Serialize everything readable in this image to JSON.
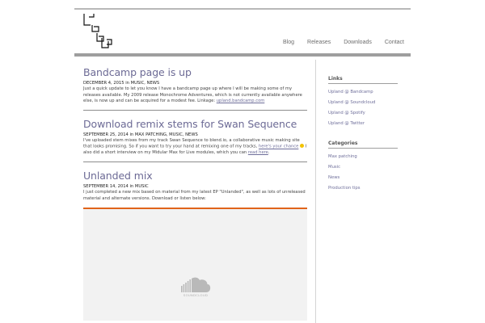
{
  "nav": {
    "items": [
      {
        "label": "Blog"
      },
      {
        "label": "Releases"
      },
      {
        "label": "Downloads"
      },
      {
        "label": "Contact"
      }
    ]
  },
  "posts": [
    {
      "title": "Bandcamp page is up",
      "date": "DECEMBER 4, 2015",
      "in": "in",
      "categories": "MUSIC, NEWS",
      "body_1": "Just a quick update to let you know I have a bandcamp page up where I will be making some of my releases available. My 2009 release Monochrome Adventures, which is not currently available anywhere else, is now up and can be acquired for a modest fee. Linkage: ",
      "link_1": "upland.bandcamp.com"
    },
    {
      "title": "Download remix stems for Swan Sequence",
      "date": "SEPTEMBER 25, 2014",
      "in": "in",
      "categories": "MAX PATCHING, MUSIC, NEWS",
      "body_1": "I've uploaded stem mixes from my track Swan Sequence to blend.io, a collaborative music making site that looks promising. So if you want to try your hand at remixing one of my tracks, ",
      "link_1": "here's your chance",
      "body_2": " I also did a short interview on my Midular Max for Live modules, which you can ",
      "link_2": "read here",
      "body_3": "."
    },
    {
      "title": "Unlanded mix",
      "date": "SEPTEMBER 14, 2014",
      "in": "in",
      "categories": "MUSIC",
      "body_1": "I just completed a new mix based on material from my latest EP \"Unlanded\", as well as lots of unreleased material and alternate versions. Download or listen below:",
      "embed_label": "SOUNDCLOUD"
    }
  ],
  "sidebar": {
    "links_title": "Links",
    "links": [
      {
        "label": "Upland @ Bandcamp"
      },
      {
        "label": "Upland @ Soundcloud"
      },
      {
        "label": "Upland @ Spotify"
      },
      {
        "label": "Upland @ Twitter"
      }
    ],
    "categories_title": "Categories",
    "categories": [
      {
        "label": "Max patching"
      },
      {
        "label": "Music"
      },
      {
        "label": "News"
      },
      {
        "label": "Production tips"
      }
    ]
  },
  "colors": {
    "title": "#6c6a95",
    "link": "#6e6e9a",
    "embed_accent": "#e0641a"
  },
  "icons": {
    "logo": "upland-logo",
    "soundcloud": "soundcloud-icon",
    "smiley": "smiley-icon"
  }
}
